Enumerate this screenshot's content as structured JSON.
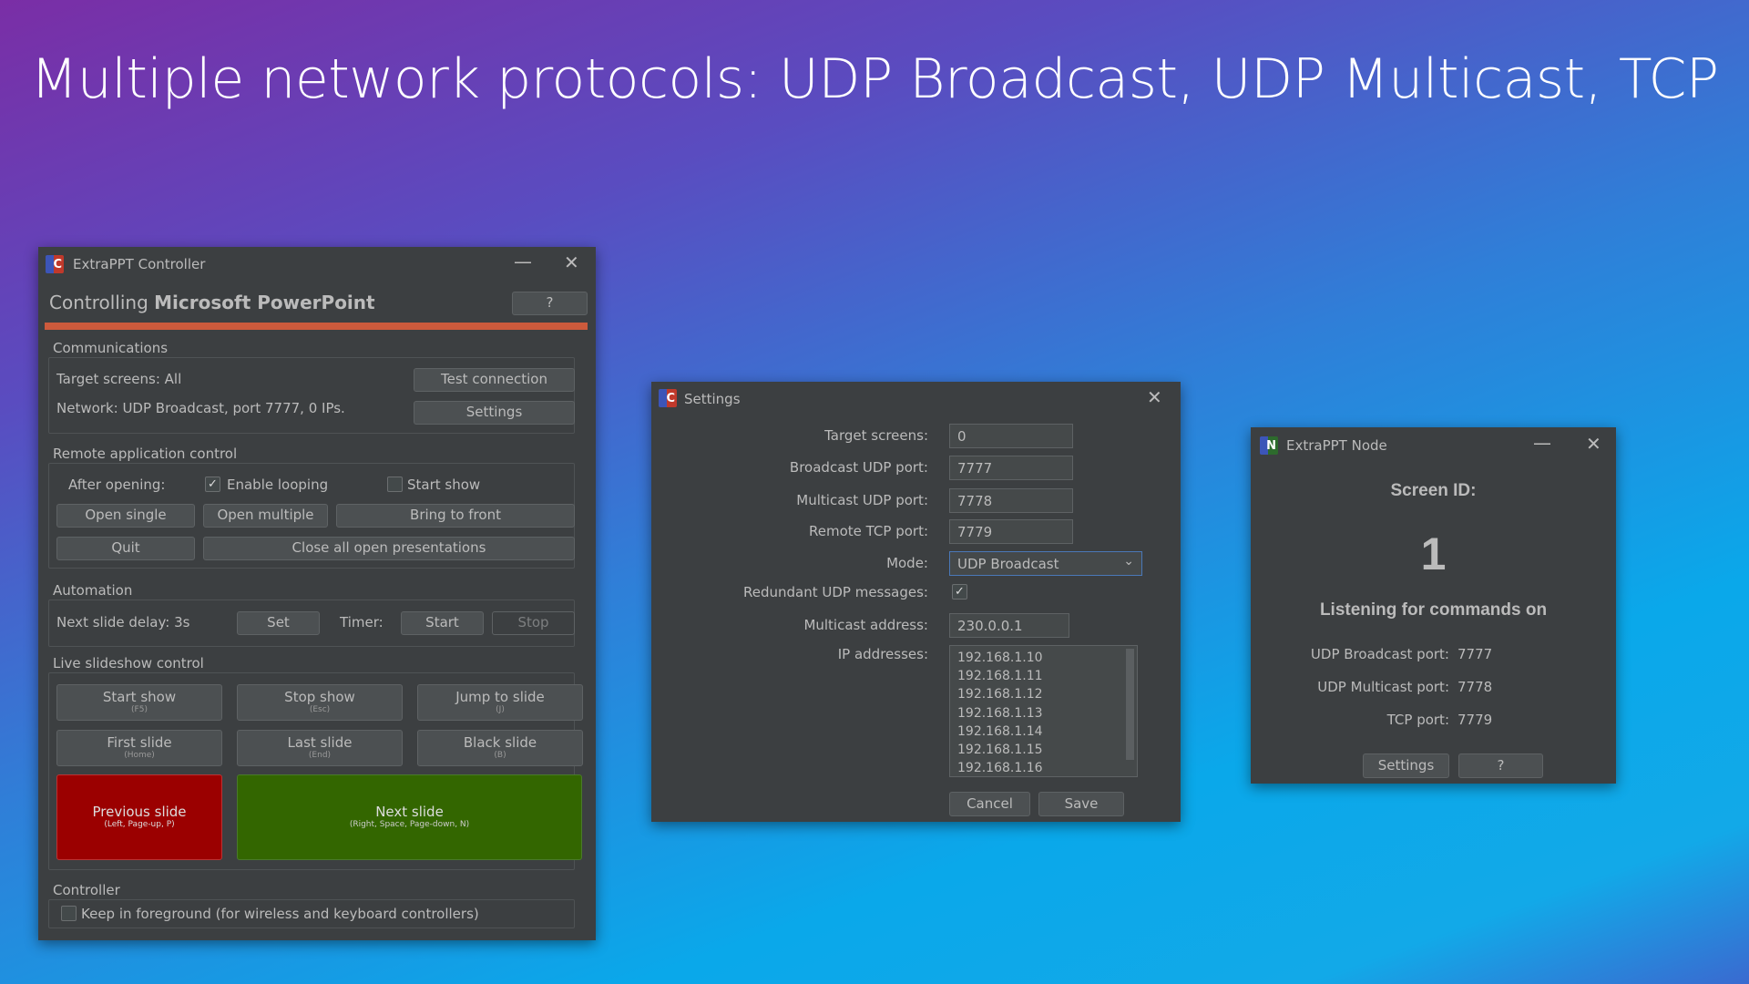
{
  "headline": "Multiple network protocols: UDP Broadcast, UDP Multicast, TCP",
  "controller": {
    "title": "ExtraPPT Controller",
    "controlling_label": "Controlling",
    "app_name": "Microsoft PowerPoint",
    "help_label": "?",
    "accent_color": "#cc5a3c",
    "communications": {
      "label": "Communications",
      "target_screens": "Target screens:  All",
      "network": "Network:  UDP Broadcast, port 7777, 0 IPs.",
      "test_connection": "Test connection",
      "settings": "Settings"
    },
    "remote": {
      "label": "Remote application control",
      "after_opening": "After opening:",
      "enable_looping": "Enable looping",
      "enable_looping_checked": true,
      "start_show": "Start show",
      "start_show_checked": false,
      "open_single": "Open single",
      "open_multiple": "Open multiple",
      "bring_to_front": "Bring to front",
      "quit": "Quit",
      "close_all": "Close all open presentations"
    },
    "automation": {
      "label": "Automation",
      "delay": "Next slide delay: 3s",
      "set": "Set",
      "timer": "Timer:",
      "start": "Start",
      "stop": "Stop"
    },
    "live": {
      "label": "Live slideshow control",
      "buttons": [
        {
          "label": "Start show",
          "key": "(F5)"
        },
        {
          "label": "Stop show",
          "key": "(Esc)"
        },
        {
          "label": "Jump to slide",
          "key": "(J)"
        },
        {
          "label": "First slide",
          "key": "(Home)"
        },
        {
          "label": "Last slide",
          "key": "(End)"
        },
        {
          "label": "Black slide",
          "key": "(B)"
        }
      ],
      "previous": {
        "label": "Previous slide",
        "key": "(Left, Page-up, P)",
        "color": "#9b0000"
      },
      "next": {
        "label": "Next slide",
        "key": "(Right, Space, Page-down, N)",
        "color": "#336600"
      }
    },
    "controller_group": {
      "label": "Controller",
      "keep_foreground": "Keep in foreground (for wireless and keyboard controllers)",
      "keep_foreground_checked": false
    }
  },
  "settings": {
    "title": "Settings",
    "target_screens": {
      "label": "Target screens:",
      "value": "0"
    },
    "broadcast_port": {
      "label": "Broadcast UDP port:",
      "value": "7777"
    },
    "multicast_port": {
      "label": "Multicast UDP port:",
      "value": "7778"
    },
    "tcp_port": {
      "label": "Remote TCP port:",
      "value": "7779"
    },
    "mode": {
      "label": "Mode:",
      "value": "UDP Broadcast"
    },
    "redundant": {
      "label": "Redundant UDP messages:",
      "checked": true
    },
    "multicast_address": {
      "label": "Multicast address:",
      "value": "230.0.0.1"
    },
    "ip_addresses": {
      "label": "IP addresses:",
      "items": [
        "192.168.1.10",
        "192.168.1.11",
        "192.168.1.12",
        "192.168.1.13",
        "192.168.1.14",
        "192.168.1.15",
        "192.168.1.16"
      ]
    },
    "cancel": "Cancel",
    "save": "Save"
  },
  "node": {
    "title": "ExtraPPT Node",
    "screen_id_label": "Screen ID:",
    "screen_id": "1",
    "listening": "Listening for commands on",
    "rows": [
      {
        "label": "UDP Broadcast port:",
        "value": "7777"
      },
      {
        "label": "UDP Multicast port:",
        "value": "7778"
      },
      {
        "label": "TCP port:",
        "value": "7779"
      }
    ],
    "settings": "Settings",
    "help": "?"
  }
}
